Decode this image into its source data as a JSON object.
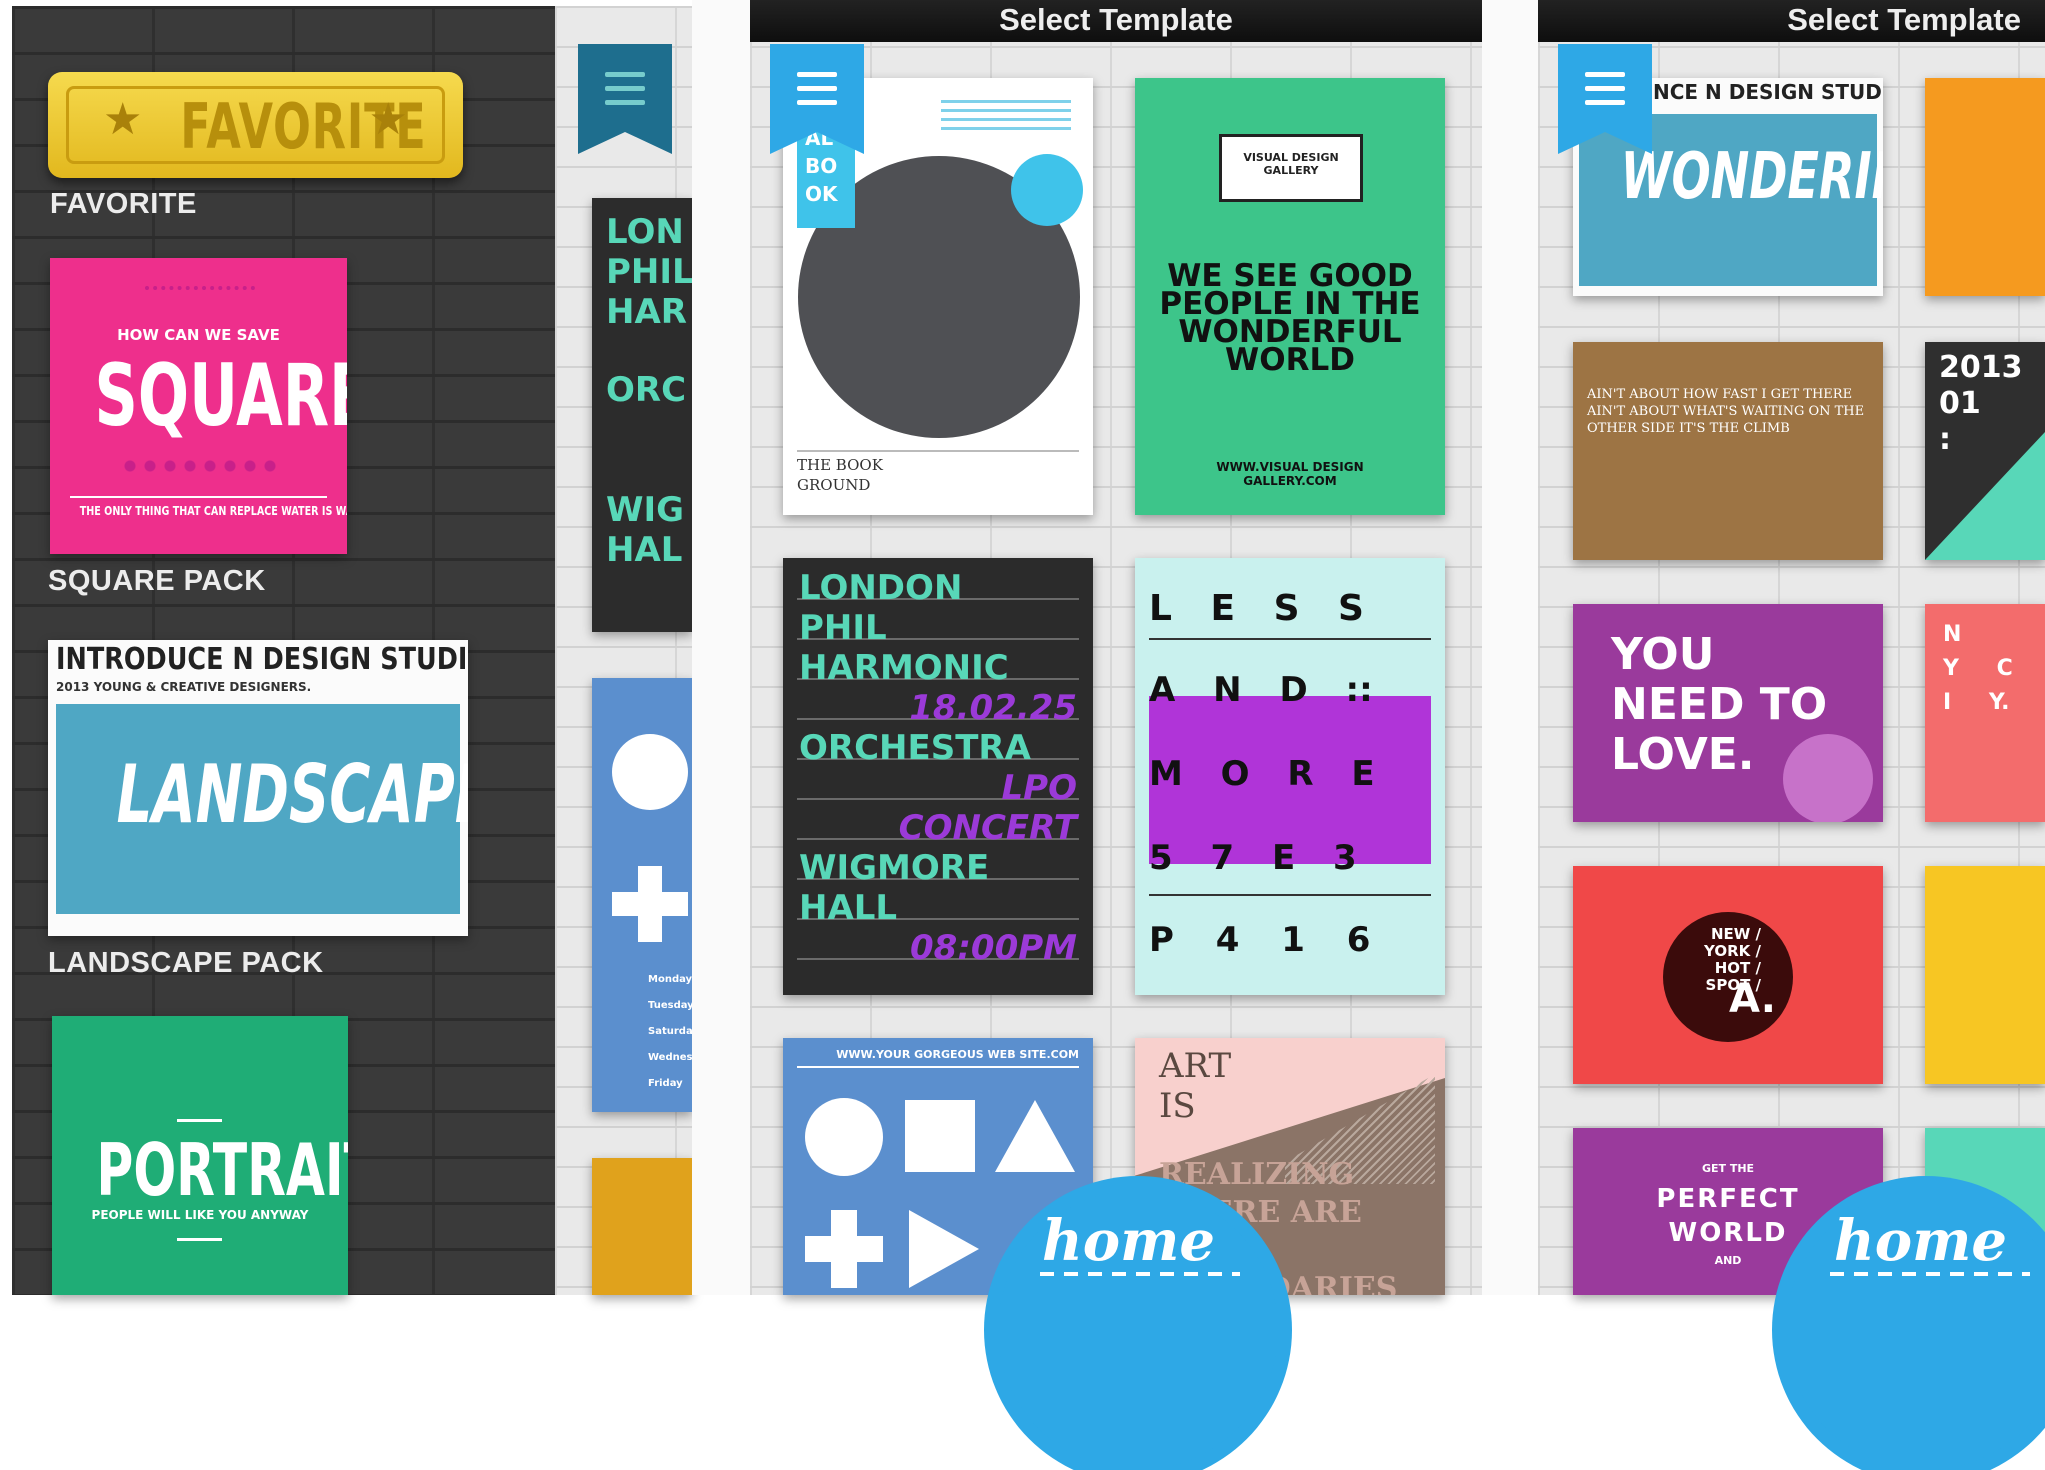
{
  "sidebar": {
    "favorite_badge": "FAVORITE",
    "favorite_label": "FAVORITE",
    "square_card": {
      "small": "HOW CAN WE SAVE",
      "title": "SQUARE",
      "footer": "THE ONLY THING THAT CAN REPLACE WATER IS WATER"
    },
    "square_label": "SQUARE PACK",
    "landscape_card": {
      "header": "INTRODUCE N DESIGN STUDIO.",
      "sub": "2013 YOUNG & CREATIVE DESIGNERS.",
      "title": "LANDSCAPE"
    },
    "landscape_label": "LANDSCAPE PACK",
    "portrait_card": {
      "title": "PORTRAIT",
      "sub": "PEOPLE WILL LIKE YOU ANYWAY"
    }
  },
  "partial_panel": {
    "poster_lines": [
      "LON",
      "PHIL",
      "HAR",
      "ORC",
      "WIG",
      "HAL"
    ],
    "schedule": [
      "Monday",
      "Tuesday",
      "Saturday",
      "Wednesday",
      "Friday"
    ]
  },
  "center": {
    "title": "Select Template",
    "book": {
      "badge": "AL BO OK",
      "footer_l1": "THE BOOK",
      "footer_l2": "GROUND"
    },
    "green": {
      "box": "VISUAL DESIGN GALLERY",
      "headline": "WE SEE GOOD PEOPLE IN THE WONDERFUL WORLD",
      "url": "WWW.VISUAL DESIGN GALLERY.COM"
    },
    "london": {
      "l1": "LONDON",
      "l2": "PHIL",
      "l3": "HARMONIC",
      "date": "18.02.25",
      "l4": "ORCHESTRA",
      "lpo": "LPO",
      "concert": "CONCERT",
      "l5": "WIGMORE",
      "l6": "HALL",
      "time": "08:00PM"
    },
    "less": {
      "r1": "L E S S",
      "r2": "A N D ::",
      "r3": "M O R E",
      "r4": "5 7 E 3",
      "r5": "P 4 1 6"
    },
    "blue": {
      "url": "WWW.YOUR GORGEOUS WEB SITE.COM"
    },
    "art": {
      "l1": "ART",
      "l2": "IS",
      "body": "REALIZING THERE ARE NO BOUNDARIES"
    },
    "home": "home"
  },
  "right": {
    "title": "Select Template",
    "wondering": {
      "header": "NCE N DESIGN STUDIO",
      "title": "WONDERING"
    },
    "brown": {
      "text": "AIN'T ABOUT HOW FAST I GET THERE AIN'T ABOUT WHAT'S WAITING ON THE OTHER SIDE IT'S THE CLIMB"
    },
    "dark": {
      "year": "2013",
      "num": "01",
      "colon": ":"
    },
    "purple": {
      "text": "YOU NEED TO LOVE."
    },
    "nyc": {
      "letters": "N Y C I Y."
    },
    "red": {
      "circle": "NEW / YORK / HOT / SPOT /",
      "big": "A."
    },
    "perfect": {
      "small": "GET THE",
      "big1": "PERFECT",
      "big2": "WORLD",
      "and": "AND"
    },
    "home": "home"
  },
  "colors": {
    "pink": "#ee2f8c",
    "green": "#3dc58a",
    "teal": "#58d7b8",
    "lavender": "#9b3ad8",
    "blue": "#2ea8e6"
  }
}
